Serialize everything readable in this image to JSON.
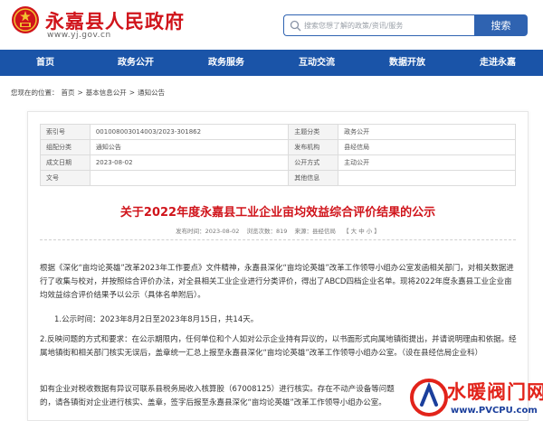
{
  "header": {
    "site_name": "永嘉县人民政府",
    "site_url": "www.yj.gov.cn",
    "search_placeholder": "搜索您想了解的政策/资讯/服务",
    "search_button": "搜索"
  },
  "nav": [
    "首页",
    "政务公开",
    "政务服务",
    "互动交流",
    "数据开放",
    "走进永嘉"
  ],
  "breadcrumb": {
    "prefix": "您现在的位置：",
    "items": [
      "首页",
      "基本信息公开",
      "通知公告"
    ],
    "separator": ">"
  },
  "meta": {
    "rows": [
      [
        {
          "k": "索引号",
          "v": "001008003014003/2023-301862"
        },
        {
          "k": "主题分类",
          "v": "政务公开"
        }
      ],
      [
        {
          "k": "组配分类",
          "v": "通知公告"
        },
        {
          "k": "发布机构",
          "v": "县经信局"
        }
      ],
      [
        {
          "k": "成文日期",
          "v": "2023-08-02"
        },
        {
          "k": "公开方式",
          "v": "主动公开"
        }
      ],
      [
        {
          "k": "文号",
          "v": ""
        },
        {
          "k": "其他信息",
          "v": ""
        }
      ]
    ]
  },
  "article": {
    "title": "关于2022年度永嘉县工业企业亩均效益综合评价结果的公示",
    "publish_time": "发布时间：2023-08-02",
    "views": "浏览次数：819",
    "source": "来源：县经信局",
    "font_size": "【 大 中 小 】",
    "paragraphs": [
      "根据《深化“亩均论英雄”改革2023年工作要点》文件精神，永嘉县深化“亩均论英雄”改革工作领导小组办公室发函相关部门，对相关数据进行了收集与校对，并按照综合评价办法，对全县相关工业企业进行分类评价，得出了ABCD四档企业名单。现将2022年度永嘉县工业企业亩均效益综合评价结果予以公示（具体名单附后）。",
      "1.公示时间：2023年8月2日至2023年8月15日，共14天。",
      "2.反映问题的方式和要求：在公示期限内，任何单位和个人如对公示企业持有异议的，以书面形式向属地镇街提出，并请说明理由和依据。经属地镇街和相关部门核实无误后，盖章统一汇总上报至永嘉县深化“亩均论英雄”改革工作领导小组办公室。（设在县经信局企业科）",
      "如有企业对税收数据有异议可联系县税务局收入核算股（67008125）进行核实。存在不动产设备等问题的，请各镇街对企业进行核实、盖章，签字后报至永嘉县深化“亩均论英雄”改革工作领导小组办公室。"
    ]
  },
  "watermark": {
    "text": "水暖阀门网",
    "url": "www.PVCPU.com"
  },
  "colors": {
    "brand_red": "#d0141b",
    "nav_blue": "#1a54a8",
    "search_blue": "#2f63b1"
  }
}
